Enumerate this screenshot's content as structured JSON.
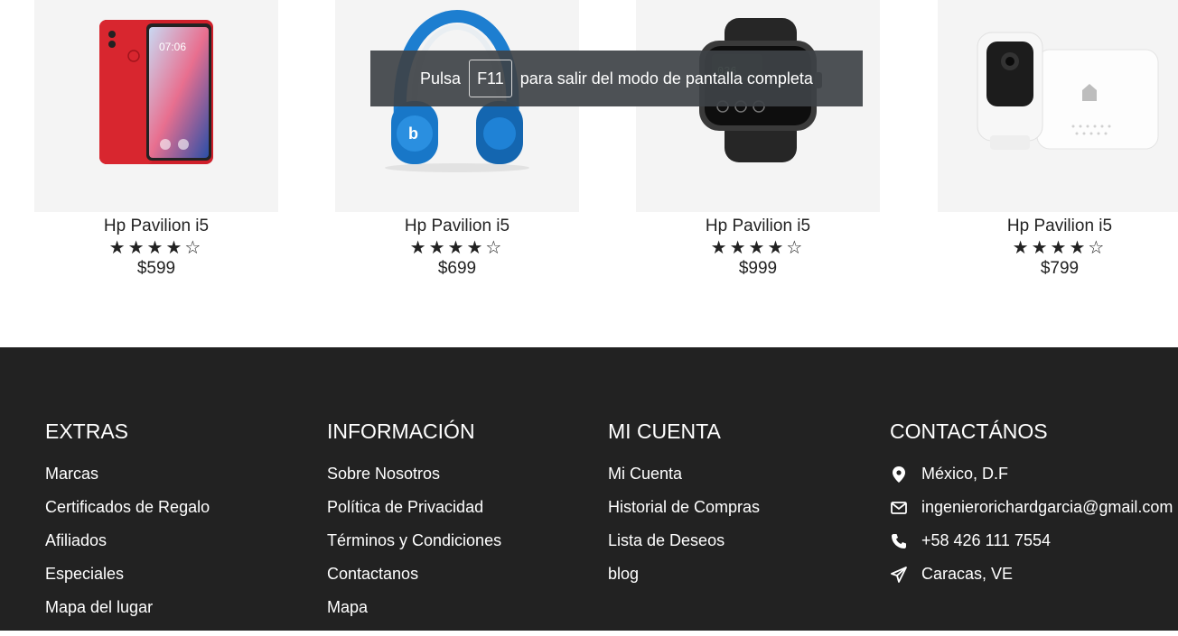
{
  "products": [
    {
      "name": "Hp Pavilion i5",
      "stars": "★★★★☆",
      "price": "$599",
      "image": "red-smartphone"
    },
    {
      "name": "Hp Pavilion i5",
      "stars": "★★★★☆",
      "price": "$699",
      "image": "blue-headphones"
    },
    {
      "name": "Hp Pavilion i5",
      "stars": "★★★★☆",
      "price": "$999",
      "image": "smartwatch"
    },
    {
      "name": "Hp Pavilion i5",
      "stars": "★★★★☆",
      "price": "$799",
      "image": "security-camera"
    }
  ],
  "rating": 4,
  "rating_max": 5,
  "fullscreen_notice": {
    "before": "Pulsa",
    "key": "F11",
    "after": "para salir del modo de pantalla completa"
  },
  "phone_clock": "07:06",
  "footer": {
    "extras": {
      "title": "EXTRAS",
      "items": [
        "Marcas",
        "Certificados de Regalo",
        "Afiliados",
        "Especiales",
        "Mapa del lugar"
      ]
    },
    "info": {
      "title": "INFORMACIÓN",
      "items": [
        "Sobre Nosotros",
        "Política de Privacidad",
        "Términos y Condiciones",
        "Contactanos",
        "Mapa"
      ]
    },
    "account": {
      "title": "MI CUENTA",
      "items": [
        "Mi Cuenta",
        "Historial de Compras",
        "Lista de Deseos",
        "blog"
      ]
    },
    "contact": {
      "title": "CONTACTÁNOS",
      "items": [
        {
          "icon": "map-pin-icon",
          "text": "México, D.F"
        },
        {
          "icon": "envelope-icon",
          "text": "ingenierorichardgarcia@gmail.com"
        },
        {
          "icon": "phone-icon",
          "text": "+58 426 111 7554"
        },
        {
          "icon": "paper-plane-icon",
          "text": "Caracas, VE"
        }
      ]
    }
  },
  "colors": {
    "footer_bg": "#222222",
    "card_bg": "#f4f4f4",
    "text": "#222222",
    "toast_bg": "#3e4246"
  }
}
